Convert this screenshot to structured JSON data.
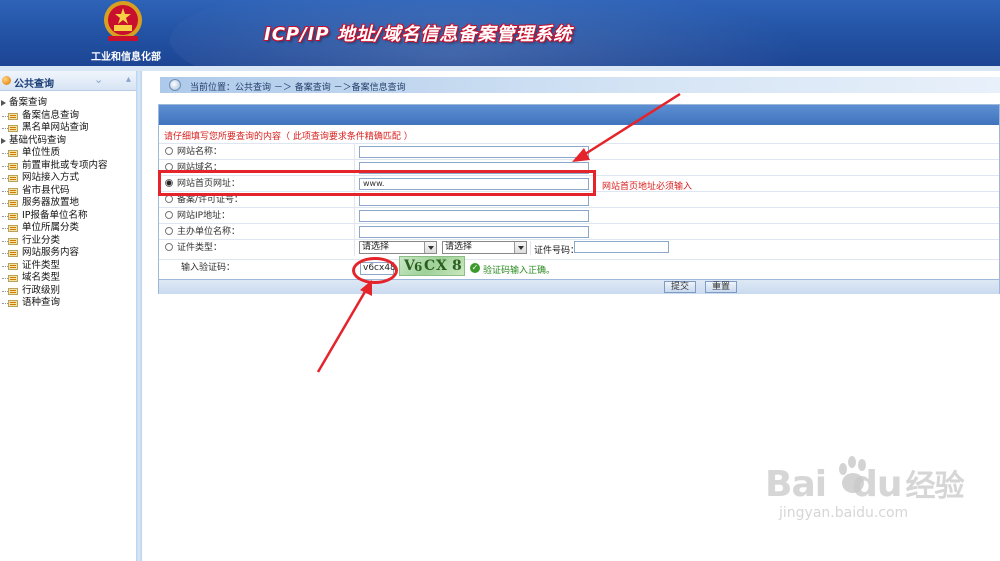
{
  "header": {
    "ministry": "工业和信息化部",
    "title": "ICP/IP 地址/域名信息备案管理系统"
  },
  "sidebar": {
    "title": "公共查询",
    "tree": [
      {
        "label": "备案查询",
        "type": "cat"
      },
      {
        "label": "备案信息查询",
        "type": "item"
      },
      {
        "label": "黑名单网站查询",
        "type": "item"
      },
      {
        "label": "基础代码查询",
        "type": "cat"
      },
      {
        "label": "单位性质",
        "type": "item"
      },
      {
        "label": "前置审批或专项内容",
        "type": "item"
      },
      {
        "label": "网站接入方式",
        "type": "item"
      },
      {
        "label": "省市县代码",
        "type": "item"
      },
      {
        "label": "服务器放置地",
        "type": "item"
      },
      {
        "label": "IP报备单位名称",
        "type": "item"
      },
      {
        "label": "单位所属分类",
        "type": "item"
      },
      {
        "label": "行业分类",
        "type": "item"
      },
      {
        "label": "网站服务内容",
        "type": "item"
      },
      {
        "label": "证件类型",
        "type": "item"
      },
      {
        "label": "域名类型",
        "type": "item"
      },
      {
        "label": "行政级别",
        "type": "item"
      },
      {
        "label": "语种查询",
        "type": "item"
      }
    ]
  },
  "breadcrumb": "当前位置：公共查询 －＞ 备案查询 －＞备案信息查询",
  "form": {
    "note": "请仔细填写您所要查询的内容（ 此项查询要求条件精确匹配 ）",
    "rows": [
      {
        "label": "网站名称：",
        "value": ""
      },
      {
        "label": "网站域名：",
        "value": ""
      },
      {
        "label": "网站首页网址：",
        "value": "www.",
        "selected": true,
        "hint": "网站首页地址必须输入"
      },
      {
        "label": "备案/许可证号：",
        "value": ""
      },
      {
        "label": "网站IP地址：",
        "value": ""
      },
      {
        "label": "主办单位名称：",
        "value": ""
      }
    ],
    "cert_row": {
      "label": "证件类型：",
      "select1": "请选择",
      "select2": "请选择",
      "cert_no_label": "证件号码："
    },
    "captcha_row": {
      "label": "输入验证码：",
      "value": "v6cx48",
      "captcha_chars": [
        "V",
        "6",
        "C",
        "X",
        "8"
      ],
      "ok_text": "验证码输入正确。"
    },
    "submit_label": "提交",
    "reset_label": "重置"
  },
  "watermark": {
    "brand": "Bai",
    "brand2": "du",
    "brand3": "经验",
    "url": "jingyan.baidu.com"
  },
  "colors": {
    "header_blue": "#2454a6",
    "annotation_red": "#e5232a",
    "warning_red": "#d8201e",
    "ok_green": "#2a8a1f"
  }
}
